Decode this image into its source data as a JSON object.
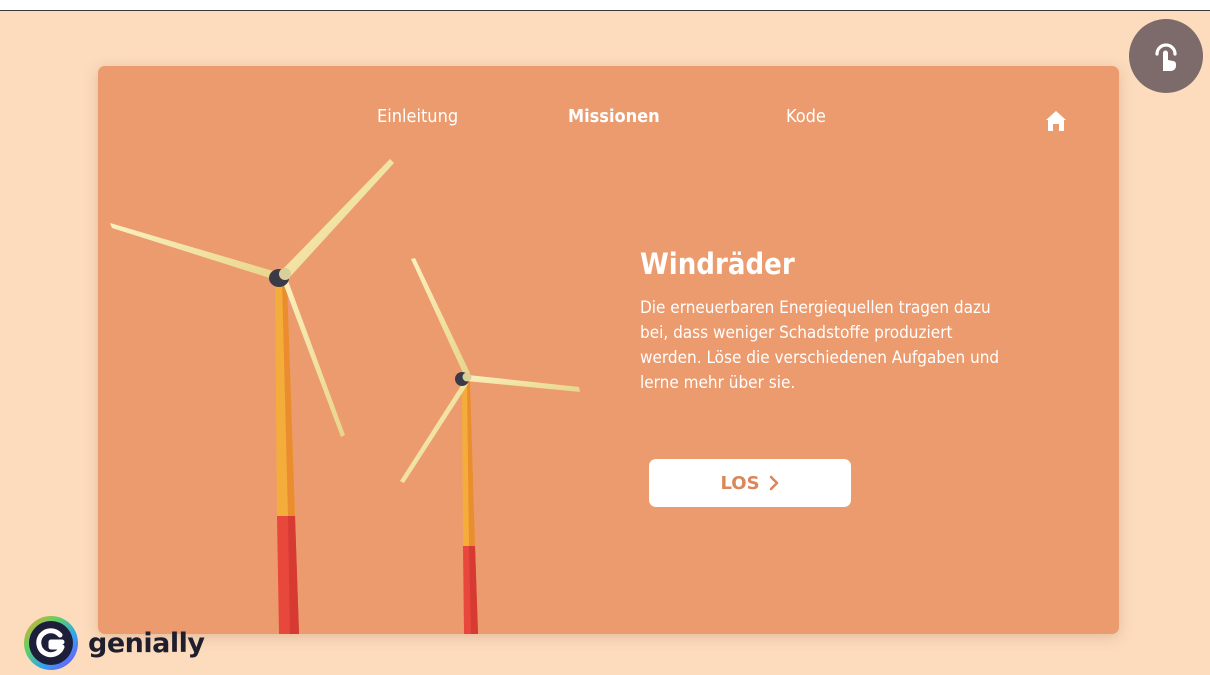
{
  "nav": {
    "items": [
      {
        "label": "Einleitung",
        "active": false
      },
      {
        "label": "Missionen",
        "active": true
      },
      {
        "label": "Kode",
        "active": false
      }
    ]
  },
  "hero": {
    "title": "Windräder",
    "text": "Die erneuerbaren Energiequellen tragen dazu bei, dass weniger Schadstoffe produziert werden. Löse die verschiedenen Aufgaben und lerne mehr über sie.",
    "button_label": "LOS"
  },
  "brand": {
    "name": "genially"
  },
  "icons": {
    "home": "home-icon",
    "touch": "touch-icon",
    "chevron": "chevron-right-icon",
    "logo": "genially-logo-icon"
  },
  "colors": {
    "page_background": "#fcdcbd",
    "card_background": "#eb9b6e",
    "button_text": "#d9875b",
    "touch_button": "#7d6b6b",
    "blade": "#f3e4a3",
    "tower_upper": "#f4ad3a",
    "tower_lower": "#e8473c"
  }
}
